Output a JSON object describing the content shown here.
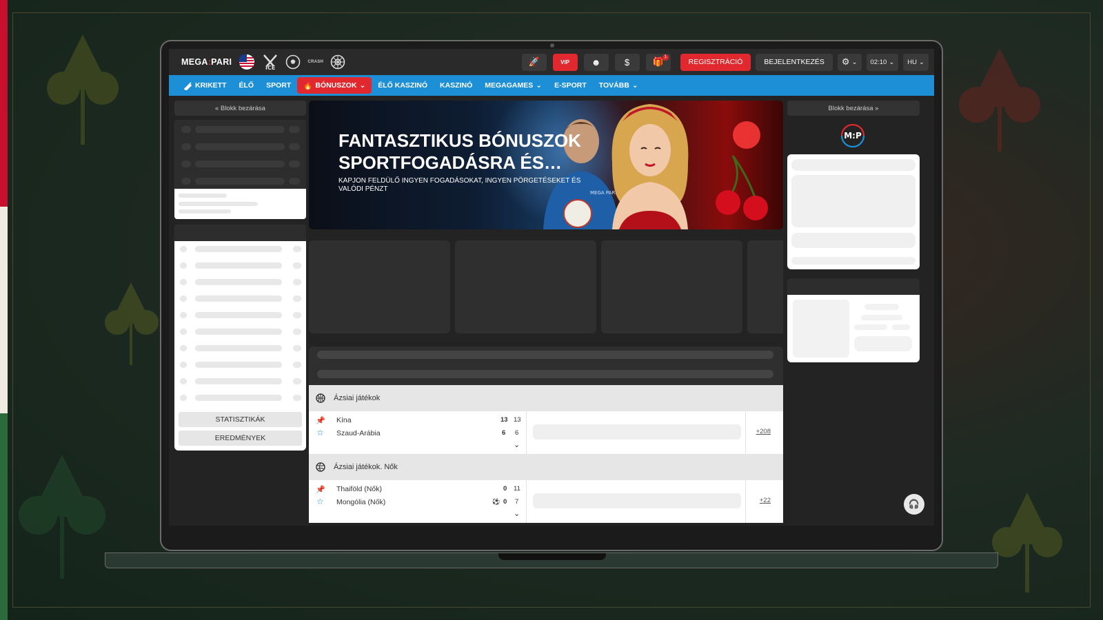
{
  "colors": {
    "brand_red": "#e0282e",
    "nav_blue": "#1d8fd6",
    "topbar": "#2a2a2a",
    "flag_red": "#c8102e",
    "flag_white": "#f0ebe0",
    "flag_green": "#2b6b3b"
  },
  "header": {
    "logo_left": "MEGA",
    "logo_sep": ":",
    "logo_right": "PARI",
    "crash_label": "CRASH",
    "vip_label": "VIP",
    "gift_badge": "1",
    "register_label": "REGISZTRÁCIÓ",
    "login_label": "BEJELENTKEZÉS",
    "time": "02:10",
    "language": "HU"
  },
  "nav": [
    {
      "label": "KRIKETT",
      "active": false
    },
    {
      "label": "ÉLŐ",
      "active": false
    },
    {
      "label": "SPORT",
      "active": false
    },
    {
      "label": "BÓNUSZOK",
      "active": true
    },
    {
      "label": "ÉLŐ KASZINÓ",
      "active": false
    },
    {
      "label": "KASZINÓ",
      "active": false
    },
    {
      "label": "MEGAGAMES",
      "active": false
    },
    {
      "label": "E-SPORT",
      "active": false
    },
    {
      "label": "TOVÁBB",
      "active": false
    }
  ],
  "left_panel": {
    "collapse_label": "Blokk bezárása",
    "statistics_label": "STATISZTIKÁK",
    "results_label": "EREDMÉNYEK"
  },
  "right_panel": {
    "collapse_label": "Blokk bezárása",
    "brand_mark": "M:P"
  },
  "banner": {
    "title": "FANTASZTIKUS BÓNUSZOK SPORTFOGADÁSRA ÉS…",
    "subtitle": "KAPJON FELDÜLŐ INGYEN FOGADÁSOKAT, INGYEN PÖRGETÉSEKET ÉS VALÓDI PÉNZT",
    "shirt_text": "MEGA PARI"
  },
  "sections": [
    {
      "name": "Ázsiai játékok",
      "match": {
        "team1": "Kína",
        "team2": "Szaud-Arábia",
        "score1_main": "13",
        "score1_sub": "13",
        "score2_main": "6",
        "score2_sub": "6",
        "more": "+208"
      }
    },
    {
      "name": "Ázsiai játékok. Nők",
      "match": {
        "team1": "Thaiföld (Nők)",
        "team2": "Mongólia (Nők)",
        "score1_main": "0",
        "score1_sub": "11",
        "score2_main": "0",
        "score2_sub": "7",
        "more": "+22"
      }
    }
  ]
}
